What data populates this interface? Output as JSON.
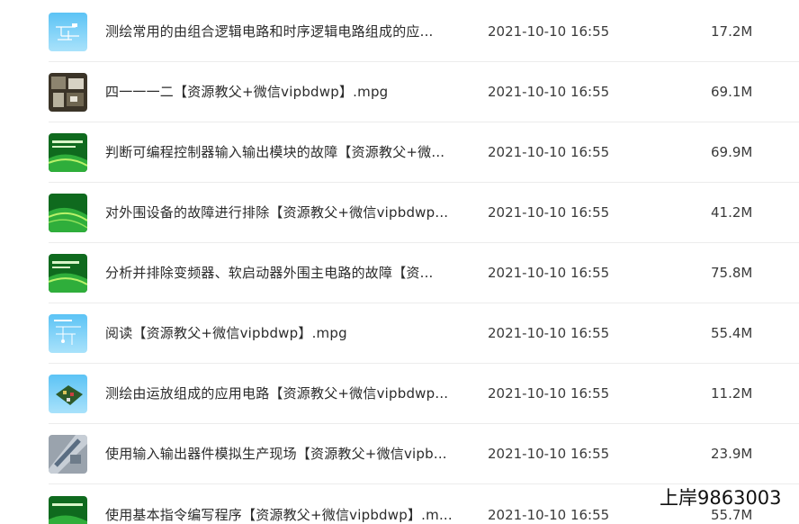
{
  "files": [
    {
      "name": "测绘常用的由组合逻辑电路和时序逻辑电路组成的应...",
      "date": "2021-10-10 16:55",
      "size": "17.2M",
      "thumb": "blue-circuit-thumbnail"
    },
    {
      "name": "四一一一二【资源教父+微信vipbdwp】.mpg",
      "date": "2021-10-10 16:55",
      "size": "69.1M",
      "thumb": "photo-thumbnail"
    },
    {
      "name": "判断可编程控制器输入输出模块的故障【资源教父+微...",
      "date": "2021-10-10 16:55",
      "size": "69.9M",
      "thumb": "green-slide-thumbnail"
    },
    {
      "name": "对外围设备的故障进行排除【资源教父+微信vipbdwp...",
      "date": "2021-10-10 16:55",
      "size": "41.2M",
      "thumb": "green-slide-thumbnail"
    },
    {
      "name": "分析并排除变频器、软启动器外围主电路的故障【资...",
      "date": "2021-10-10 16:55",
      "size": "75.8M",
      "thumb": "green-slide-thumbnail"
    },
    {
      "name": "阅读【资源教父+微信vipbdwp】.mpg",
      "date": "2021-10-10 16:55",
      "size": "55.4M",
      "thumb": "blue-circuit-thumbnail"
    },
    {
      "name": "测绘由运放组成的应用电路【资源教父+微信vipbdwp...",
      "date": "2021-10-10 16:55",
      "size": "11.2M",
      "thumb": "blue-board-thumbnail"
    },
    {
      "name": "使用输入输出器件模拟生产现场【资源教父+微信vipb...",
      "date": "2021-10-10 16:55",
      "size": "23.9M",
      "thumb": "photo-thumbnail"
    },
    {
      "name": "使用基本指令编写程序【资源教父+微信vipbdwp】.m...",
      "date": "2021-10-10 16:55",
      "size": "55.7M",
      "thumb": "green-slide-thumbnail"
    }
  ],
  "watermark": "上岸9863003"
}
